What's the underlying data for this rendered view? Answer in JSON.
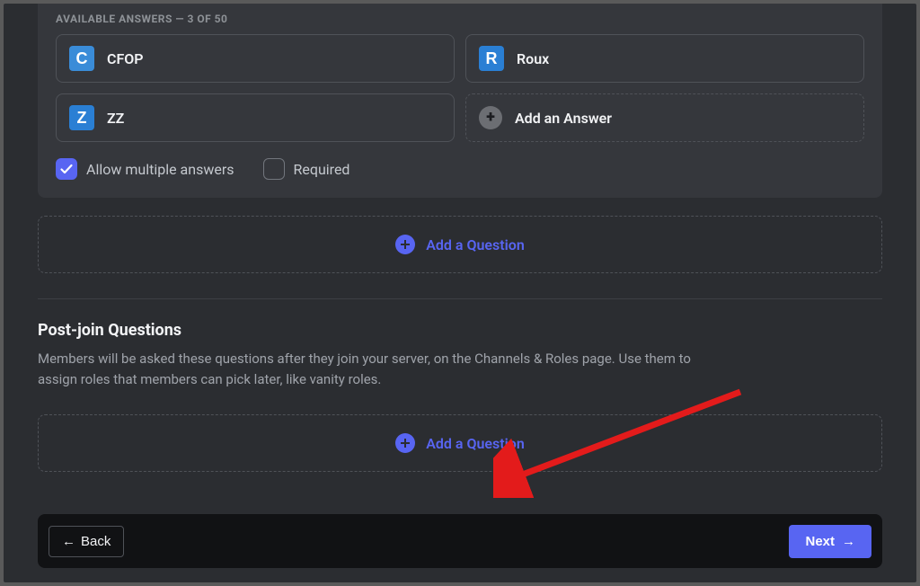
{
  "answers_header": "AVAILABLE ANSWERS — 3 OF 50",
  "answers": [
    {
      "emoji": "C",
      "label": "CFOP"
    },
    {
      "emoji": "R",
      "label": "Roux"
    },
    {
      "emoji": "Z",
      "label": "ZZ"
    }
  ],
  "add_answer_label": "Add an Answer",
  "options": {
    "allow_multiple": {
      "label": "Allow multiple answers",
      "checked": true
    },
    "required": {
      "label": "Required",
      "checked": false
    }
  },
  "add_question1": "Add a Question",
  "post_join": {
    "title": "Post-join Questions",
    "desc": "Members will be asked these questions after they join your server, on the Channels & Roles page. Use them to assign roles that members can pick later, like vanity roles."
  },
  "add_question2": "Add a Question",
  "footer": {
    "back": "Back",
    "next": "Next"
  }
}
